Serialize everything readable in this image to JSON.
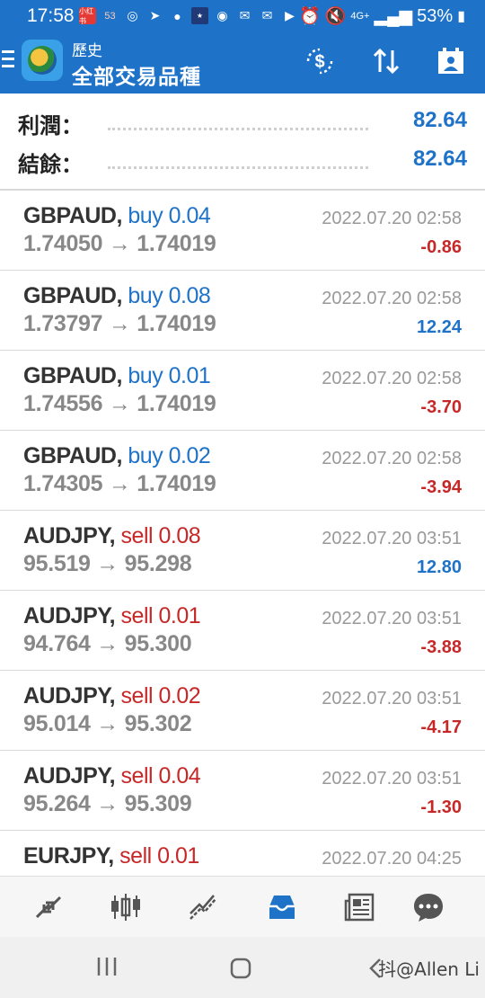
{
  "status_bar": {
    "time": "17:58",
    "signal": "4G+",
    "battery": "53%"
  },
  "app_bar": {
    "title": "歷史",
    "subtitle": "全部交易品種"
  },
  "summary": {
    "profit_label": "利潤：",
    "profit_value": "82.64",
    "balance_label": "結餘：",
    "balance_value": "82.64"
  },
  "trades": [
    {
      "symbol": "GBPAUD,",
      "side": "buy 0.04",
      "prices": "1.74050 → 1.74019",
      "datetime": "2022.07.20 02:58",
      "profit": "-0.86"
    },
    {
      "symbol": "GBPAUD,",
      "side": "buy 0.08",
      "prices": "1.73797 → 1.74019",
      "datetime": "2022.07.20 02:58",
      "profit": "12.24"
    },
    {
      "symbol": "GBPAUD,",
      "side": "buy 0.01",
      "prices": "1.74556 → 1.74019",
      "datetime": "2022.07.20 02:58",
      "profit": "-3.70"
    },
    {
      "symbol": "GBPAUD,",
      "side": "buy 0.02",
      "prices": "1.74305 → 1.74019",
      "datetime": "2022.07.20 02:58",
      "profit": "-3.94"
    },
    {
      "symbol": "AUDJPY,",
      "side": "sell 0.08",
      "prices": "95.519 → 95.298",
      "datetime": "2022.07.20 03:51",
      "profit": "12.80"
    },
    {
      "symbol": "AUDJPY,",
      "side": "sell 0.01",
      "prices": "94.764 → 95.300",
      "datetime": "2022.07.20 03:51",
      "profit": "-3.88"
    },
    {
      "symbol": "AUDJPY,",
      "side": "sell 0.02",
      "prices": "95.014 → 95.302",
      "datetime": "2022.07.20 03:51",
      "profit": "-4.17"
    },
    {
      "symbol": "AUDJPY,",
      "side": "sell 0.04",
      "prices": "95.264 → 95.309",
      "datetime": "2022.07.20 03:51",
      "profit": "-1.30"
    },
    {
      "symbol": "EURJPY,",
      "side": "sell 0.01",
      "prices": "",
      "datetime": "2022.07.20 04:25",
      "profit": ""
    }
  ],
  "bottom_nav": [
    "quotes-icon",
    "chart-icon",
    "trade-icon",
    "history-icon",
    "news-icon",
    "chat-icon"
  ],
  "watermark": "抖@Allen Li",
  "colors": {
    "accent": "#1e73c9",
    "negative": "#c62828",
    "buy": "#1e73c9",
    "sell": "#c62828"
  }
}
